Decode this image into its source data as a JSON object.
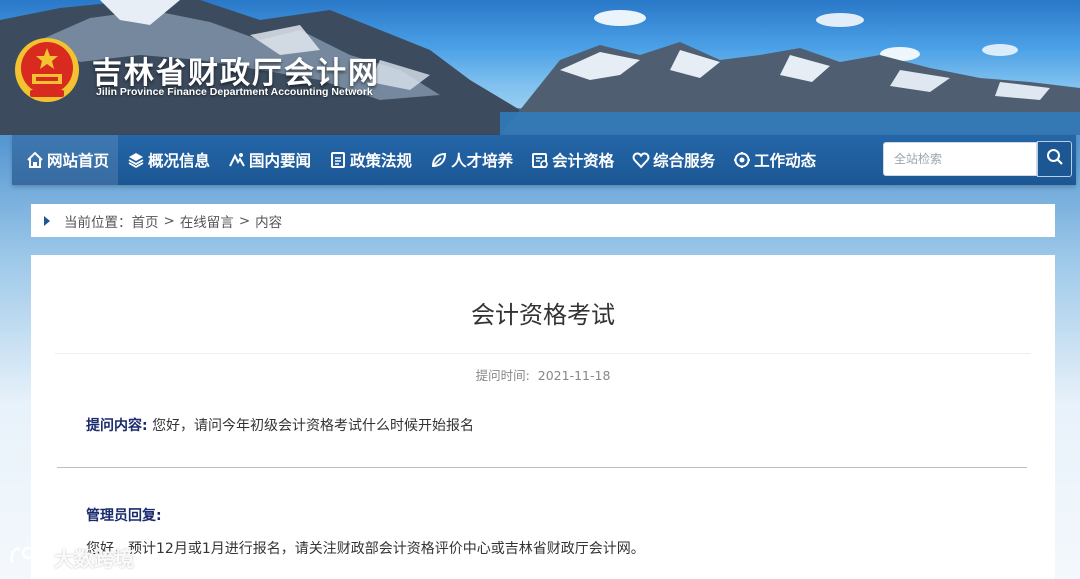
{
  "header": {
    "site_title": "吉林省财政厅会计网",
    "site_subtitle": "Jilin Province Finance Department Accounting Network"
  },
  "nav": {
    "items": [
      {
        "label": "网站首页",
        "icon": "home-icon"
      },
      {
        "label": "概况信息",
        "icon": "layers-icon"
      },
      {
        "label": "国内要闻",
        "icon": "news-icon"
      },
      {
        "label": "政策法规",
        "icon": "document-icon"
      },
      {
        "label": "人才培养",
        "icon": "leaf-icon"
      },
      {
        "label": "会计资格",
        "icon": "certificate-icon"
      },
      {
        "label": "综合服务",
        "icon": "heart-icon"
      },
      {
        "label": "工作动态",
        "icon": "gear-icon"
      }
    ],
    "search_placeholder": "全站检索"
  },
  "breadcrumb": {
    "prefix": "当前位置：",
    "items": [
      "首页",
      "在线留言",
      "内容"
    ],
    "separator": ">"
  },
  "article": {
    "title": "会计资格考试",
    "ask_time_label": "提问时间:",
    "ask_time_value": "2021-11-18",
    "question_label": "提问内容:",
    "question_text": "您好，请问今年初级会计资格考试什么时候开始报名",
    "reply_label": "管理员回复:",
    "reply_text": "您好，预计12月或1月进行报名，请关注财政部会计资格评价中心或吉林省财政厅会计网。"
  },
  "watermark": {
    "text": "大数跨境"
  },
  "colors": {
    "nav_bg": "#1c5794",
    "label_navy": "#1a2b6d",
    "page_bg": "#9ec9e9"
  }
}
